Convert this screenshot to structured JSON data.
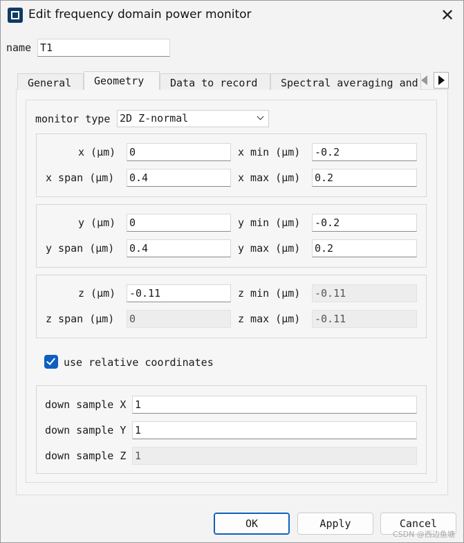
{
  "window": {
    "title": "Edit frequency domain power monitor",
    "icon": "app-icon",
    "close_icon": "close-icon"
  },
  "name_field": {
    "label": "name",
    "value": "T1"
  },
  "tabs": [
    {
      "label": "General"
    },
    {
      "label": "Geometry"
    },
    {
      "label": "Data to record"
    },
    {
      "label": "Spectral averaging and a"
    }
  ],
  "geometry": {
    "monitor_type": {
      "label": "monitor type",
      "value": "2D Z-normal"
    },
    "x": {
      "center": {
        "label": "x (μm)",
        "value": "0"
      },
      "span": {
        "label": "x span (μm)",
        "value": "0.4"
      },
      "min": {
        "label": "x min (μm)",
        "value": "-0.2"
      },
      "max": {
        "label": "x max (μm)",
        "value": "0.2"
      }
    },
    "y": {
      "center": {
        "label": "y (μm)",
        "value": "0"
      },
      "span": {
        "label": "y span (μm)",
        "value": "0.4"
      },
      "min": {
        "label": "y min (μm)",
        "value": "-0.2"
      },
      "max": {
        "label": "y max (μm)",
        "value": "0.2"
      }
    },
    "z": {
      "center": {
        "label": "z (μm)",
        "value": "-0.11"
      },
      "span": {
        "label": "z span (μm)",
        "value": "0"
      },
      "min": {
        "label": "z min (μm)",
        "value": "-0.11"
      },
      "max": {
        "label": "z max (μm)",
        "value": "-0.11"
      }
    },
    "use_relative": {
      "label": "use relative coordinates",
      "checked": true
    },
    "down_sample": {
      "x": {
        "label": "down sample X",
        "value": "1"
      },
      "y": {
        "label": "down sample Y",
        "value": "1"
      },
      "z": {
        "label": "down sample Z",
        "value": "1"
      }
    }
  },
  "buttons": {
    "ok": "OK",
    "apply": "Apply",
    "cancel": "Cancel"
  },
  "watermark": "CSDN @西边鱼塘",
  "colors": {
    "accent": "#0f5fbf",
    "window_bg": "#f3f3f3"
  }
}
